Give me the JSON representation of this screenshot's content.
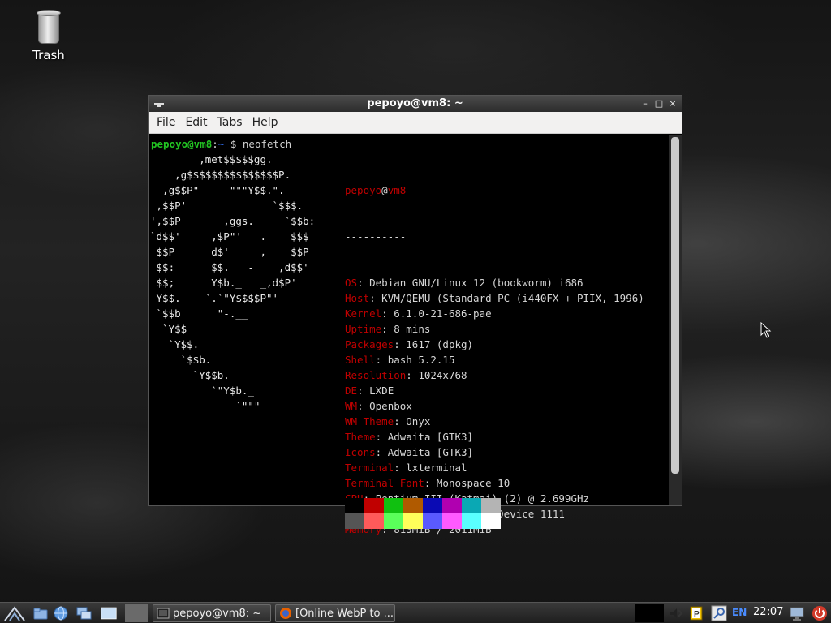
{
  "desktop": {
    "trash_label": "Trash"
  },
  "window": {
    "title": "pepoyo@vm8: ~",
    "controls": {
      "minimize": "–",
      "maximize": "□",
      "close": "×"
    },
    "menu": [
      "File",
      "Edit",
      "Tabs",
      "Help"
    ]
  },
  "terminal": {
    "prompt_user": "pepoyo@vm8",
    "prompt_path": "~",
    "prompt_symbol": ":",
    "prompt_rest": "$ neofetch",
    "logo_lines": [
      [
        "       _,met$$$$$gg.",
        ""
      ],
      [
        "    ,g$$$$$$$$$$$$$$$P.",
        ""
      ],
      [
        "  ,g$$P\"     \"\"\"Y$$.\".",
        ""
      ],
      [
        " ,$$P'              `$$$.",
        ""
      ],
      [
        "',$$P       ,ggs.     `$$b:",
        ""
      ],
      [
        "`d$$'     ,$P\"'   .    $$$",
        ""
      ],
      [
        " $$P      d$'     ,    $$P",
        ""
      ],
      [
        " $$:      $$.   -    ,d$$'",
        ""
      ],
      [
        " $$;      Y$b._   _,d$P'",
        ""
      ],
      [
        " Y$$.    `.`\"Y$$$$P\"'",
        ""
      ],
      [
        " `$$b      \"-.__",
        ""
      ],
      [
        "  `Y$$",
        ""
      ],
      [
        "   `Y$$.",
        ""
      ],
      [
        "     `$$b.",
        ""
      ],
      [
        "       `Y$$b.",
        ""
      ],
      [
        "          `\"Y$b._",
        ""
      ],
      [
        "              `\"\"\"",
        ""
      ]
    ],
    "header_user": "pepoyo",
    "header_at": "@",
    "header_host": "vm8",
    "separator": "----------",
    "info": [
      {
        "key": "OS",
        "value": "Debian GNU/Linux 12 (bookworm) i686"
      },
      {
        "key": "Host",
        "value": "KVM/QEMU (Standard PC (i440FX + PIIX, 1996)"
      },
      {
        "key": "Kernel",
        "value": "6.1.0-21-686-pae"
      },
      {
        "key": "Uptime",
        "value": "8 mins"
      },
      {
        "key": "Packages",
        "value": "1617 (dpkg)"
      },
      {
        "key": "Shell",
        "value": "bash 5.2.15"
      },
      {
        "key": "Resolution",
        "value": "1024x768"
      },
      {
        "key": "DE",
        "value": "LXDE"
      },
      {
        "key": "WM",
        "value": "Openbox"
      },
      {
        "key": "WM Theme",
        "value": "Onyx"
      },
      {
        "key": "Theme",
        "value": "Adwaita [GTK3]"
      },
      {
        "key": "Icons",
        "value": "Adwaita [GTK3]"
      },
      {
        "key": "Terminal",
        "value": "lxterminal"
      },
      {
        "key": "Terminal Font",
        "value": "Monospace 10"
      },
      {
        "key": "CPU",
        "value": "Pentium III (Katmai) (2) @ 2.699GHz"
      },
      {
        "key": "GPU",
        "value": "00:03.0 Vendor 1234 Device 1111"
      },
      {
        "key": "Memory",
        "value": "813MiB / 2011MiB"
      }
    ],
    "palette_top": [
      "#000000",
      "#c00000",
      "#10c010",
      "#b05a00",
      "#0a0ab4",
      "#b000b0",
      "#0aa8b4",
      "#b4b4b4"
    ],
    "palette_bottom": [
      "#555555",
      "#ff5a5a",
      "#5aff5a",
      "#ffff5a",
      "#5a5aff",
      "#ff5aff",
      "#5affff",
      "#ffffff"
    ]
  },
  "taskbar": {
    "tasks": [
      {
        "label": "pepoyo@vm8: ~",
        "icon": "terminal-icon"
      },
      {
        "label": "[Online WebP to ...",
        "icon": "firefox-icon"
      }
    ],
    "language": "EN",
    "clock": "22:07"
  },
  "colors": {
    "key_red": "#c00000",
    "prompt_green": "#22c322",
    "prompt_blue": "#2a62d8"
  }
}
